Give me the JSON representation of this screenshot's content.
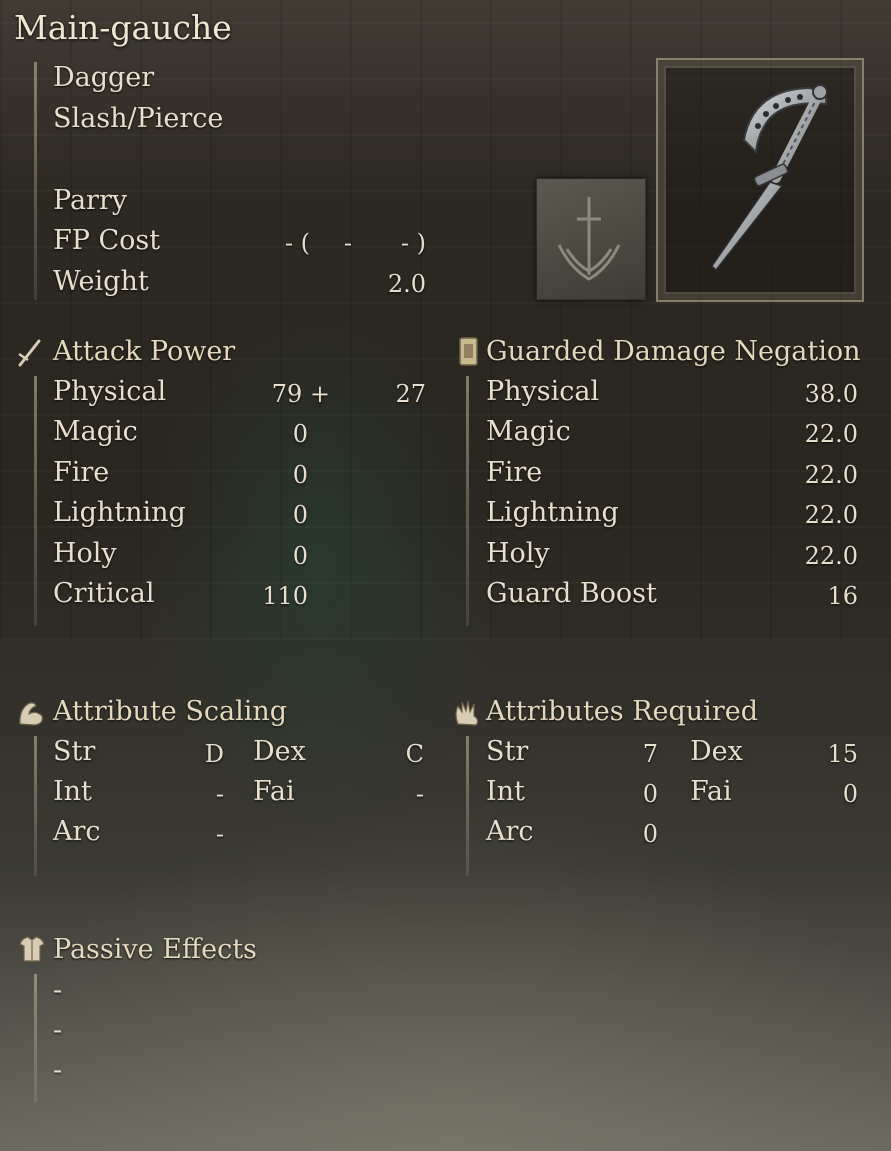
{
  "weapon": {
    "name": "Main-gauche",
    "type": "Dagger",
    "damage_type": "Slash/Pierce",
    "skill": "Parry",
    "fp_cost_label": "FP Cost",
    "fp_cost_open": "- (",
    "fp_cost_mid": "-",
    "fp_cost_close": "- )",
    "weight_label": "Weight",
    "weight_value": "2.0"
  },
  "attack_power": {
    "title": "Attack Power",
    "icon": "sword-icon",
    "rows": [
      {
        "label": "Physical",
        "value": "79 +",
        "bonus": "27"
      },
      {
        "label": "Magic",
        "value": "0"
      },
      {
        "label": "Fire",
        "value": "0"
      },
      {
        "label": "Lightning",
        "value": "0"
      },
      {
        "label": "Holy",
        "value": "0"
      },
      {
        "label": "Critical",
        "value": "110"
      }
    ]
  },
  "guard": {
    "title": "Guarded Damage Negation",
    "icon": "shield-icon",
    "rows": [
      {
        "label": "Physical",
        "value": "38.0"
      },
      {
        "label": "Magic",
        "value": "22.0"
      },
      {
        "label": "Fire",
        "value": "22.0"
      },
      {
        "label": "Lightning",
        "value": "22.0"
      },
      {
        "label": "Holy",
        "value": "22.0"
      },
      {
        "label": "Guard Boost",
        "value": "16"
      }
    ]
  },
  "scaling": {
    "title": "Attribute Scaling",
    "icon": "flexed-arm-icon",
    "str": {
      "label": "Str",
      "value": "D"
    },
    "dex": {
      "label": "Dex",
      "value": "C"
    },
    "int": {
      "label": "Int",
      "value": "-"
    },
    "fai": {
      "label": "Fai",
      "value": "-"
    },
    "arc": {
      "label": "Arc",
      "value": "-"
    }
  },
  "requirements": {
    "title": "Attributes Required",
    "icon": "hand-icon",
    "str": {
      "label": "Str",
      "value": "7"
    },
    "dex": {
      "label": "Dex",
      "value": "15"
    },
    "int": {
      "label": "Int",
      "value": "0"
    },
    "fai": {
      "label": "Fai",
      "value": "0"
    },
    "arc": {
      "label": "Arc",
      "value": "0"
    }
  },
  "passive": {
    "title": "Passive Effects",
    "icon": "armor-icon",
    "lines": [
      "-",
      "-",
      "-"
    ]
  },
  "colors": {
    "text": "#e7dfcc",
    "header": "#e4d8bd",
    "frame": "#d2c8aa"
  }
}
